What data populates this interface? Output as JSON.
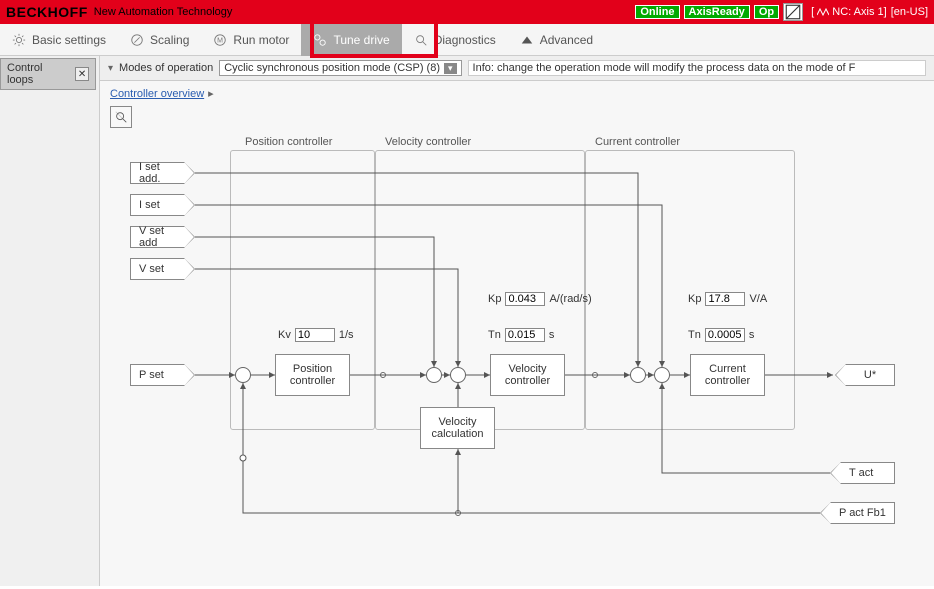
{
  "header": {
    "logo": "BECKHOFF",
    "tagline": "New Automation Technology",
    "status": {
      "online": "Online",
      "axis": "AxisReady",
      "op": "Op"
    },
    "device": "NC: Axis 1",
    "locale": "[en-US]"
  },
  "tabs": {
    "basic": "Basic settings",
    "scaling": "Scaling",
    "run": "Run motor",
    "tune": "Tune drive",
    "diag": "Diagnostics",
    "adv": "Advanced"
  },
  "side": {
    "loops": "Control loops"
  },
  "modes": {
    "label": "Modes of operation",
    "value": "Cyclic synchronous position mode (CSP) (8)",
    "info": "Info: change the operation mode will modify the process data on the mode of F"
  },
  "breadcrumb": {
    "overview": "Controller overview"
  },
  "groups": {
    "pos": "Position controller",
    "vel": "Velocity controller",
    "cur": "Current controller"
  },
  "signals": {
    "isetadd": "I set add.",
    "iset": "I set",
    "vsetadd": "V set add",
    "vset": "V set",
    "pset": "P set",
    "ustar": "U*",
    "tact": "T act",
    "pactfb1": "P act Fb1"
  },
  "blocks": {
    "pos": "Position controller",
    "vel": "Velocity controller",
    "cur": "Current controller",
    "vcalc": "Velocity calculation"
  },
  "params": {
    "kv": {
      "label": "Kv",
      "value": "10",
      "unit": "1/s"
    },
    "vkp": {
      "label": "Kp",
      "value": "0.043",
      "unit": "A/(rad/s)"
    },
    "vtn": {
      "label": "Tn",
      "value": "0.015",
      "unit": "s"
    },
    "ckp": {
      "label": "Kp",
      "value": "17.8",
      "unit": "V/A"
    },
    "ctn": {
      "label": "Tn",
      "value": "0.0005",
      "unit": "s"
    }
  }
}
